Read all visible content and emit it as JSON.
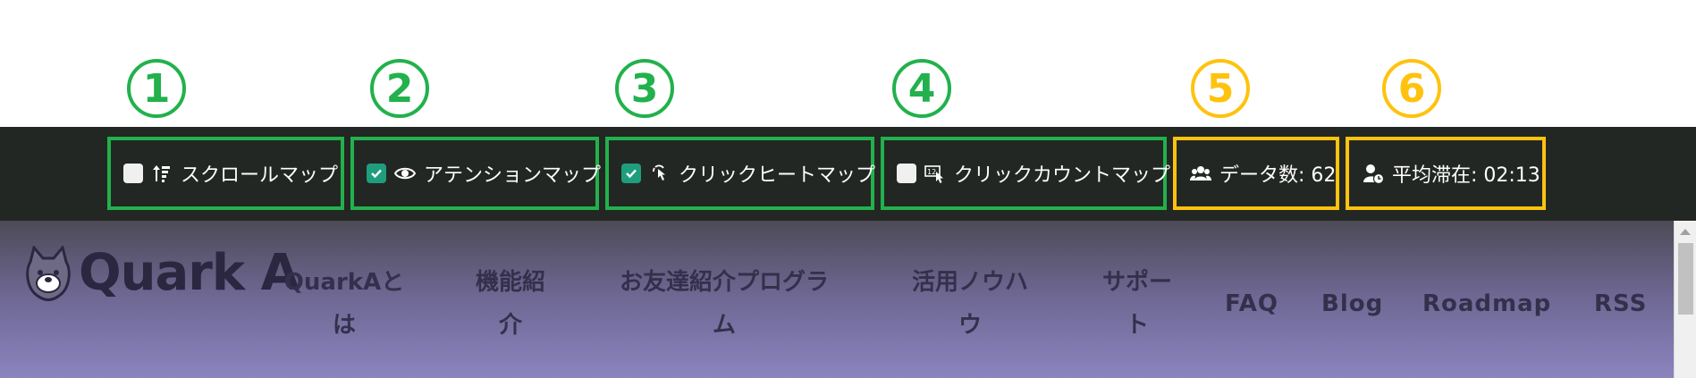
{
  "callouts": [
    "1",
    "2",
    "3",
    "4",
    "5",
    "6"
  ],
  "toolbar": {
    "scroll_map": {
      "label": "スクロールマップ",
      "checked": false,
      "icon": "scroll-sort-icon"
    },
    "attention_map": {
      "label": "アテンションマップ",
      "checked": true,
      "icon": "eye-icon"
    },
    "click_heat_map": {
      "label": "クリックヒートマップ",
      "checked": true,
      "icon": "click-pointer-icon"
    },
    "click_count_map": {
      "label": "クリックカウントマップ",
      "checked": false,
      "icon": "click-count-icon"
    },
    "data_count": {
      "label": "データ数: 62",
      "icon": "users-icon"
    },
    "avg_stay": {
      "label": "平均滞在: 02:13",
      "icon": "user-clock-icon"
    }
  },
  "site": {
    "logo_text": "Quark A",
    "nav": [
      {
        "line1": "QuarkAと",
        "line2": "は"
      },
      {
        "line1": "機能紹",
        "line2": "介"
      },
      {
        "line1": "お友達紹介プログラ",
        "line2": "ム"
      },
      {
        "line1": "活用ノウハ",
        "line2": "ウ"
      },
      {
        "line1": "サポー",
        "line2": "ト"
      },
      {
        "line1": "FAQ"
      },
      {
        "line1": "Blog"
      },
      {
        "line1": "Roadmap"
      },
      {
        "line1": "RSS"
      }
    ]
  },
  "colors": {
    "toolbar_bg": "#232723",
    "feature_outline": "#22b14c",
    "stat_outline": "#ffc20e",
    "checkbox_checked": "#1e9e7d",
    "nav_text": "#34304c"
  }
}
